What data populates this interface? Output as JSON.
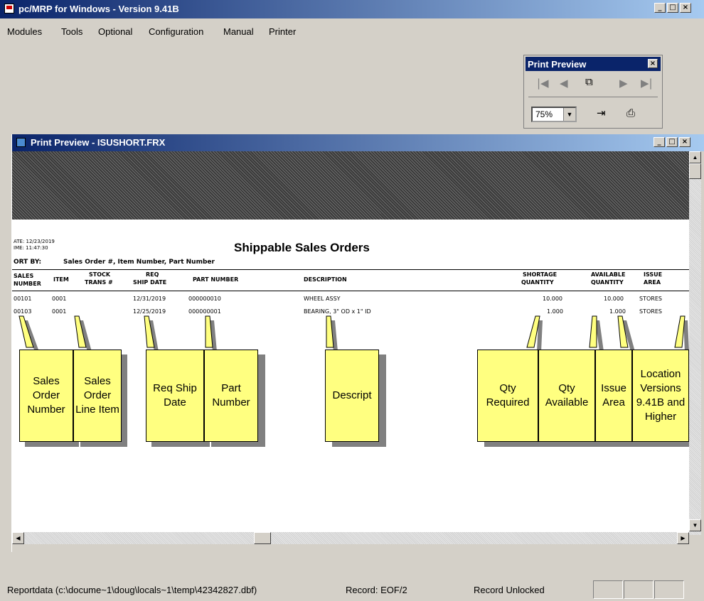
{
  "app": {
    "title": "pc/MRP for Windows - Version 9.41B",
    "window_buttons": [
      "_",
      "□",
      "×"
    ]
  },
  "menu": [
    "Modules",
    "Tools",
    "Optional",
    "Configuration",
    "Manual",
    "Printer"
  ],
  "print_toolbar": {
    "title": "Print Preview",
    "zoom_value": "75%",
    "buttons": [
      "first-page",
      "previous-page",
      "multi-page",
      "next-page",
      "last-page",
      "close-preview",
      "print"
    ]
  },
  "preview_window": {
    "title": "Print Preview - ISUSHORT.FRX"
  },
  "report": {
    "date": "ATE: 12/23/2019",
    "time": "IME: 11:47:30",
    "title": "Shippable Sales Orders",
    "sort_label": "ORT BY:",
    "sort_value": "Sales Order #, Item Number, Part Number",
    "headers": {
      "sales_number": [
        "SALES",
        "NUMBER"
      ],
      "item": [
        "ITEM"
      ],
      "stock_trans": [
        "STOCK",
        "TRANS #"
      ],
      "req_ship": [
        "REQ",
        "SHIP DATE"
      ],
      "part_number": [
        "PART NUMBER"
      ],
      "description": [
        "DESCRIPTION"
      ],
      "shortage_qty": [
        "SHORTAGE",
        "QUANTITY"
      ],
      "available_qty": [
        "AVAILABLE",
        "QUANTITY"
      ],
      "issue_area": [
        "ISSUE",
        "AREA"
      ]
    },
    "rows": [
      {
        "sales": "00101",
        "item": "0001",
        "ship": "12/31/2019",
        "part": "000000010",
        "desc": "WHEEL ASSY",
        "short": "10.000",
        "avail": "10.000",
        "area": "STORES"
      },
      {
        "sales": "00103",
        "item": "0001",
        "ship": "12/25/2019",
        "part": "000000001",
        "desc": "BEARING, 3\" OD x 1\" ID",
        "short": "1.000",
        "avail": "1.000",
        "area": "STORES"
      }
    ]
  },
  "callouts": {
    "sales_order_number": "Sales Order Number",
    "line_item": "Sales Order Line Item",
    "req_ship_date": "Req Ship Date",
    "part_number": "Part Number",
    "descript": "Descript",
    "qty_required": "Qty Required",
    "qty_available": "Qty Available",
    "issue_area": "Issue Area",
    "location": "Location Versions 9.41B and Higher"
  },
  "status": {
    "reportdata": "Reportdata (c:\\docume~1\\doug\\locals~1\\temp\\42342827.dbf)",
    "record": "Record: EOF/2",
    "lock": "Record Unlocked"
  }
}
